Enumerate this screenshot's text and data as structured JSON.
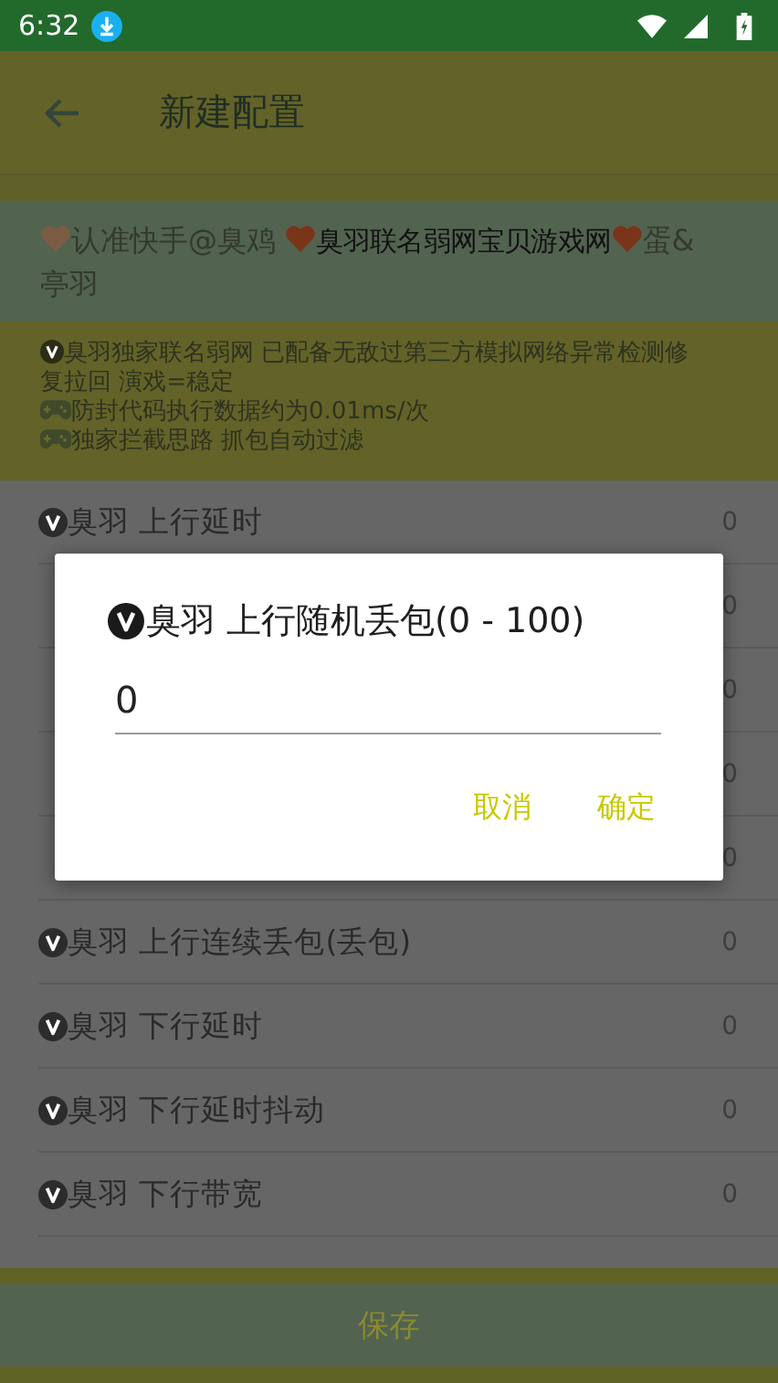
{
  "status_bar": {
    "time": "6:32"
  },
  "app_bar": {
    "title": "新建配置"
  },
  "banner": [
    {
      "kind": "heart",
      "color": "#7c5c44"
    },
    {
      "kind": "text",
      "text": "认准快手@臭鸡 ",
      "emphasis": false
    },
    {
      "kind": "heart",
      "color": "#7a3418"
    },
    {
      "kind": "text",
      "text": "臭羽联名弱网宝贝游戏网",
      "emphasis": true
    },
    {
      "kind": "heart",
      "color": "#7a3418"
    },
    {
      "kind": "text",
      "text": "蛋&亭羽",
      "emphasis": false
    }
  ],
  "notice": [
    {
      "kind": "verified",
      "text": "臭羽独家联名弱网 已配备无敌过第三方模拟网络异常检测修复拉回 演戏=稳定"
    },
    {
      "kind": "game",
      "text": "防封代码执行数据约为0.01ms/次"
    },
    {
      "kind": "game",
      "text": "独家拦截思路 抓包自动过滤"
    }
  ],
  "settings": [
    {
      "label": "臭羽 上行延时",
      "value": "0"
    },
    {
      "value": "0"
    },
    {
      "value": "0"
    },
    {
      "value": "0"
    },
    {
      "value": "0"
    },
    {
      "label": "臭羽 上行连续丢包(丢包)",
      "value": "0"
    },
    {
      "label": "臭羽 下行延时",
      "value": "0"
    },
    {
      "label": "臭羽 下行延时抖动",
      "value": "0"
    },
    {
      "label": "臭羽 下行带宽",
      "value": "0"
    }
  ],
  "save_button": "保存",
  "dialog": {
    "title": "臭羽 上行随机丢包(0 - 100)",
    "value": "0",
    "buttons": [
      "取消",
      "确定"
    ]
  }
}
